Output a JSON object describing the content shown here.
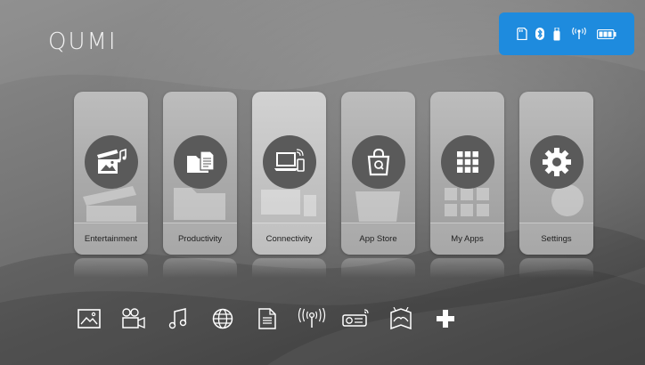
{
  "brand": {
    "logo_text": "QUMI"
  },
  "status_bar": {
    "background": "#1e8bde",
    "icons": [
      "sd-card-icon",
      "bluetooth-icon",
      "usb-drive-icon",
      "wifi-icon",
      "battery-icon"
    ]
  },
  "tiles": [
    {
      "label": "Entertainment",
      "icon": "media-icon"
    },
    {
      "label": "Productivity",
      "icon": "folder-docs-icon"
    },
    {
      "label": "Connectivity",
      "icon": "laptop-cast-icon",
      "active": true
    },
    {
      "label": "App Store",
      "icon": "shopping-bag-icon"
    },
    {
      "label": "My Apps",
      "icon": "grid-icon"
    },
    {
      "label": "Settings",
      "icon": "gear-icon"
    }
  ],
  "quick_bar": {
    "icons": [
      "photo-icon",
      "video-icon",
      "music-icon",
      "web-browser-icon",
      "document-icon",
      "wireless-icon",
      "projector-cast-icon",
      "screen-mirror-icon",
      "add-icon"
    ]
  }
}
